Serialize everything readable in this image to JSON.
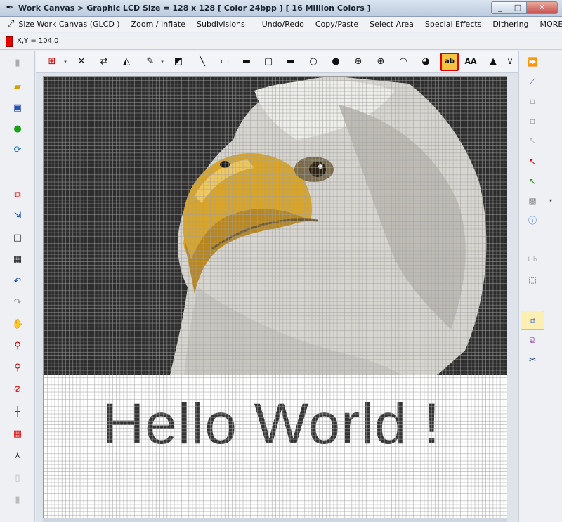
{
  "window": {
    "title": "Work Canvas > Graphic LCD Size = 128 x 128 [ Color 24bpp ] [ 16 Million Colors ]",
    "minimize": "_",
    "maximize": "□",
    "close": "✕"
  },
  "menu": {
    "items": [
      "Size Work Canvas (GLCD )",
      "Zoom / Inflate",
      "Subdivisions",
      "Undo/Redo",
      "Copy/Paste",
      "Select Area",
      "Special Effects",
      "Dithering",
      "MORE >>"
    ]
  },
  "status": {
    "coords": "X,Y = 104,0",
    "swatch_color": "#e80000"
  },
  "draw_toolbar": {
    "text_tool_label": "ab",
    "font_tool_label": "AA",
    "active_tool": "text-tool",
    "active_border_color": "#e00000",
    "active_fill_color": "#f5c542"
  },
  "left_toolbar": [
    "new-file-icon",
    "open-folder-icon",
    "save-icon",
    "play-icon",
    "refresh-icon",
    "crop-icon",
    "resize-icon",
    "square-icon",
    "grid-icon",
    "undo-icon",
    "redo-icon",
    "hand-pan-icon",
    "zoom-in-icon",
    "zoom-out-icon",
    "zoom-reset-icon",
    "crosshair-icon",
    "red-grid-icon",
    "compass-icon",
    "page-icon",
    "page-blank-icon"
  ],
  "right_toolbar": [
    "fast-forward-icon",
    "eyedropper-icon",
    "small-square-icon",
    "small-square-icon",
    "pointer-icon",
    "red-pointer-add-icon",
    "green-pointer-icon",
    "checker-pattern-icon",
    "info-icon",
    "lib-add-icon",
    "select-color-icon",
    "copy-layers-icon",
    "paste-layers-icon",
    "scissors-icon"
  ],
  "canvas": {
    "glcd_size": "128 x 128",
    "text": "Hello World !",
    "text_color": "#333333",
    "background_color": "#2d2d2d"
  }
}
